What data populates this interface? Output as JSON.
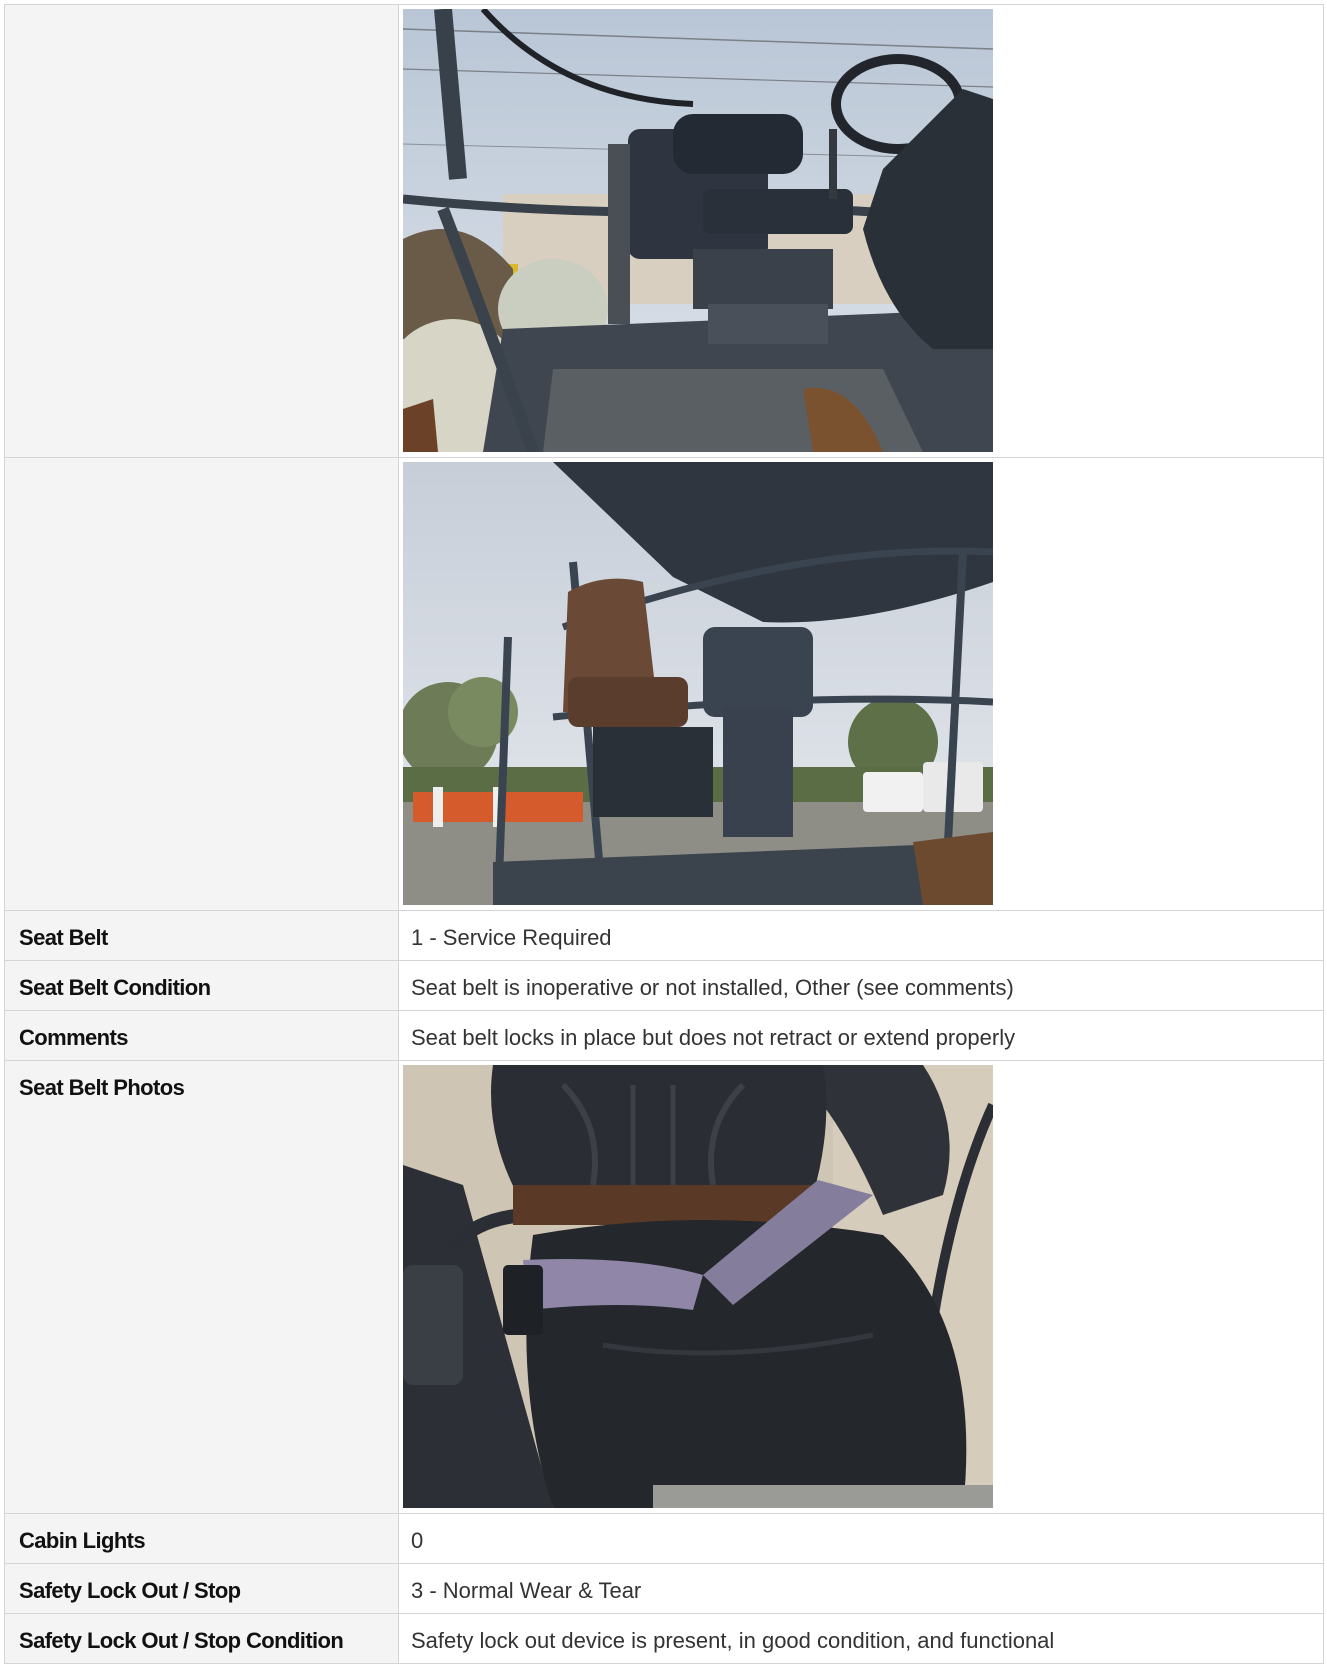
{
  "rows": [
    {
      "label": "",
      "photos": [
        "seat-with-steering-wheel-photo"
      ]
    },
    {
      "label": "",
      "photos": [
        "seat-under-canopy-photo"
      ]
    },
    {
      "label": "Seat Belt",
      "value": "1 - Service Required"
    },
    {
      "label": "Seat Belt Condition",
      "value": "Seat belt is inoperative or not installed, Other (see comments)"
    },
    {
      "label": "Comments",
      "value": "Seat belt locks in place but does not retract or extend properly"
    },
    {
      "label": "Seat Belt Photos",
      "photos": [
        "seat-belt-closeup-photo"
      ]
    },
    {
      "label": "Cabin Lights",
      "value": "0"
    },
    {
      "label": "Safety Lock Out / Stop",
      "value": "3 - Normal Wear & Tear"
    },
    {
      "label": "Safety Lock Out / Stop Condition",
      "value": "Safety lock out device is present, in good condition, and functional"
    }
  ],
  "colors": {
    "label_bg": "#f4f4f4",
    "border": "#d4d4d4",
    "text": "#333333"
  }
}
